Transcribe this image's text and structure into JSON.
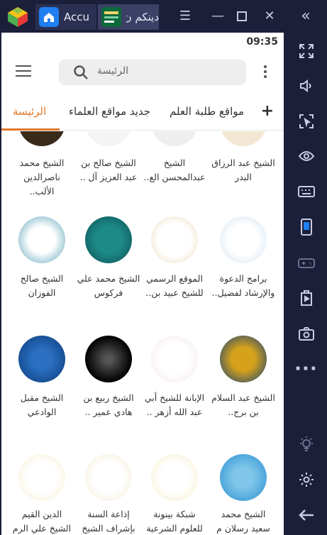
{
  "titlebar": {
    "tabs": [
      {
        "label": "Accu",
        "icon": "home-icon"
      },
      {
        "label": "دينكم ن",
        "icon": "app-thumbnail-icon"
      }
    ],
    "buttons": [
      "menu-icon",
      "minimize-icon",
      "maximize-icon",
      "close-icon",
      "collapse-sidebar-icon"
    ]
  },
  "sidebar": {
    "buttons": [
      "fullscreen-icon",
      "volume-icon",
      "screenshot-region-icon",
      "eye-icon",
      "keyboard-icon",
      "phone-icon",
      "gamepad-icon",
      "install-apk-icon",
      "camera-icon",
      "more-icon",
      "brightness-icon",
      "settings-icon",
      "back-icon"
    ]
  },
  "status": {
    "time": "09:35"
  },
  "search": {
    "placeholder": "الرئيسة"
  },
  "tabs": [
    "الرئيسة",
    "جديد مواقع العلماء",
    "مواقع طلبة العلم"
  ],
  "plus": "+",
  "sites": [
    [
      "الشيخ عبد الرزاق البدر",
      "الشيخ عبدالمحسن الع..",
      "الشيخ صالح بن عبد العزيز آل ..",
      "الشيخ محمد ناصرالدين الألب.."
    ],
    [
      "برامج الدعوة والإرشاد لفضيل..",
      "الموقع الرسمي للشيخ عبيد بن..",
      "الشيخ محمد علي فركوس",
      "الشيخ صالح الفوزان"
    ],
    [
      "الشيخ عبد السلام بن برج..",
      "الإبانة للشيخ أبي عبد الله أزهر ..",
      "الشيخ ربيع بن هادي عمير ..",
      "الشيخ مقبل الوادعي"
    ],
    [
      "الشيخ محمد سعيد رسلان م",
      "شبكة بينونة للعلوم الشرعية",
      "إذاعة السنة بإشراف الشيخ",
      "الدين القيم الشيخ علي الرم"
    ]
  ],
  "colors": {
    "accent": "#e0782a",
    "chrome": "#1b1f3a"
  }
}
